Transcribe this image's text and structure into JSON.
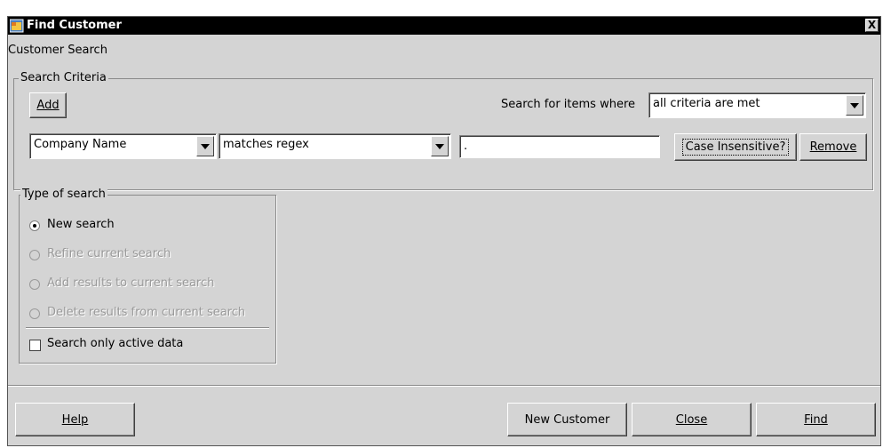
{
  "window": {
    "title": "Find Customer",
    "close_symbol": "X"
  },
  "section_label": "Customer Search",
  "criteria": {
    "legend": "Search Criteria",
    "add_label": "Add",
    "search_for_label": "Search for items where",
    "match_mode": "all criteria are met",
    "field": "Company Name",
    "operator": "matches regex",
    "value": ".",
    "case_insensitive_label": "Case Insensitive?",
    "remove_label": "Remove"
  },
  "search_type": {
    "legend": "Type of search",
    "options": [
      {
        "label": "New search",
        "selected": true,
        "enabled": true
      },
      {
        "label": "Refine current search",
        "selected": false,
        "enabled": false
      },
      {
        "label": "Add results to current search",
        "selected": false,
        "enabled": false
      },
      {
        "label": "Delete results from current search",
        "selected": false,
        "enabled": false
      }
    ],
    "active_only_label": "Search only active data"
  },
  "buttons": {
    "help": "Help",
    "new_customer": "New Customer",
    "close": "Close",
    "find": "Find"
  }
}
